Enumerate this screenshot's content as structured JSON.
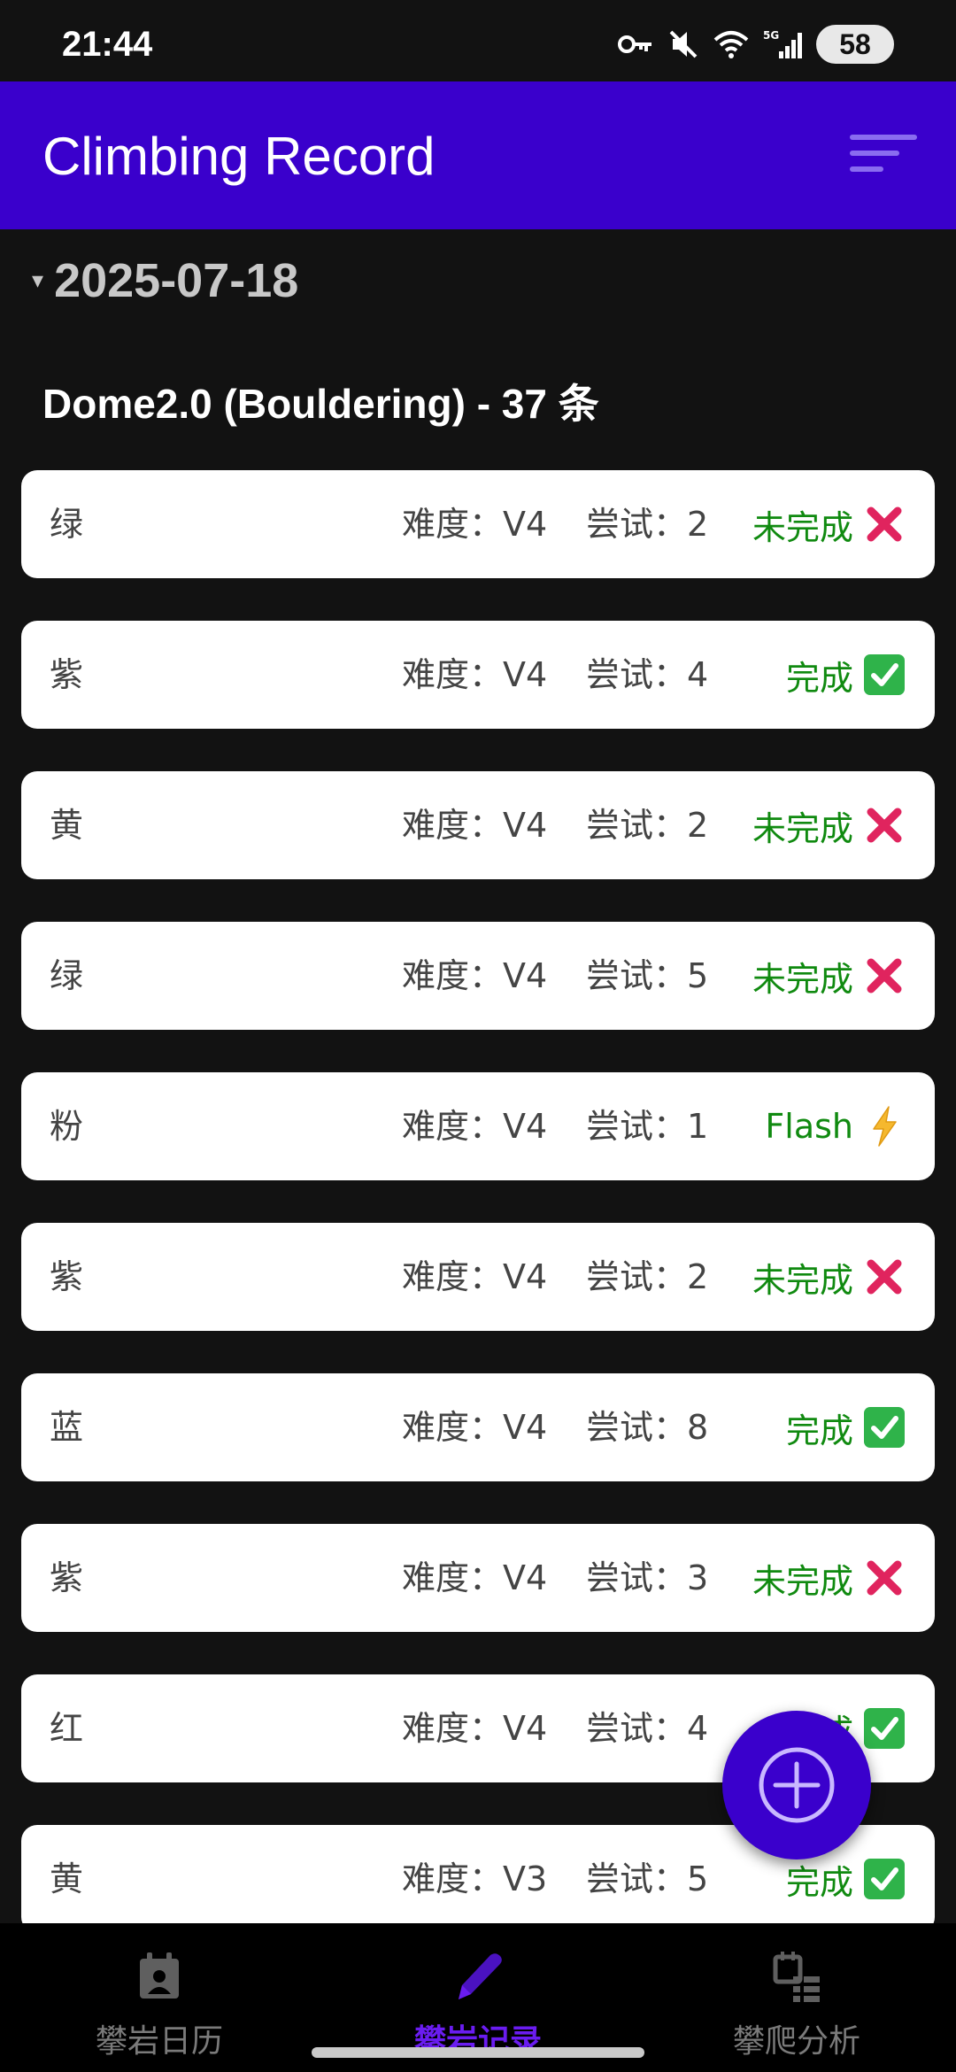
{
  "status_bar": {
    "time": "21:44",
    "battery": "58"
  },
  "app_bar": {
    "title": "Climbing Record"
  },
  "date_group": {
    "date": "2025-07-18",
    "arrow": "▾"
  },
  "gym": {
    "title": "Dome2.0 (Bouldering) - 37 条"
  },
  "records": [
    {
      "color": "绿",
      "difficulty": "难度：V4",
      "attempts": "尝试：2",
      "status": "未完成",
      "status_icon": "cross-mark-icon"
    },
    {
      "color": "紫",
      "difficulty": "难度：V4",
      "attempts": "尝试：4",
      "status": "完成",
      "status_icon": "check-mark-icon"
    },
    {
      "color": "黄",
      "difficulty": "难度：V4",
      "attempts": "尝试：2",
      "status": "未完成",
      "status_icon": "cross-mark-icon"
    },
    {
      "color": "绿",
      "difficulty": "难度：V4",
      "attempts": "尝试：5",
      "status": "未完成",
      "status_icon": "cross-mark-icon"
    },
    {
      "color": "粉",
      "difficulty": "难度：V4",
      "attempts": "尝试：1",
      "status": "Flash",
      "status_icon": "lightning-icon"
    },
    {
      "color": "紫",
      "difficulty": "难度：V4",
      "attempts": "尝试：2",
      "status": "未完成",
      "status_icon": "cross-mark-icon"
    },
    {
      "color": "蓝",
      "difficulty": "难度：V4",
      "attempts": "尝试：8",
      "status": "完成",
      "status_icon": "check-mark-icon"
    },
    {
      "color": "紫",
      "difficulty": "难度：V4",
      "attempts": "尝试：3",
      "status": "未完成",
      "status_icon": "cross-mark-icon"
    },
    {
      "color": "红",
      "difficulty": "难度：V4",
      "attempts": "尝试：4",
      "status": "完成",
      "status_icon": "check-mark-icon"
    },
    {
      "color": "黄",
      "difficulty": "难度：V3",
      "attempts": "尝试：5",
      "status": "完成",
      "status_icon": "check-mark-icon"
    }
  ],
  "bottom_nav": [
    {
      "label": "攀岩日历",
      "icon": "calendar-icon",
      "active": false
    },
    {
      "label": "攀岩记录",
      "icon": "pencil-icon",
      "active": true
    },
    {
      "label": "攀爬分析",
      "icon": "analysis-icon",
      "active": false
    }
  ],
  "colors": {
    "primary": "#3a00cc",
    "active_nav": "#6a1cf0",
    "status_text": "#108a10",
    "background": "#121212",
    "card": "#ffffff"
  }
}
